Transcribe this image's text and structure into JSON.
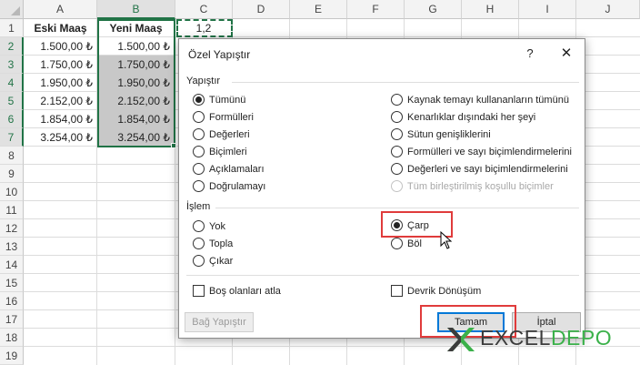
{
  "sheet": {
    "columns": [
      "A",
      "B",
      "C",
      "D",
      "E",
      "F",
      "G",
      "H",
      "I",
      "J"
    ],
    "rows": [
      "1",
      "2",
      "3",
      "4",
      "5",
      "6",
      "7",
      "8",
      "9",
      "10",
      "11",
      "12",
      "13",
      "14",
      "15",
      "16",
      "17",
      "18",
      "19"
    ],
    "header_row": {
      "a": "Eski Maaş",
      "b": "Yeni Maaş",
      "c": "1,2"
    },
    "data": [
      {
        "a": "1.500,00 ₺",
        "b": "1.500,00 ₺"
      },
      {
        "a": "1.750,00 ₺",
        "b": "1.750,00 ₺"
      },
      {
        "a": "1.950,00 ₺",
        "b": "1.950,00 ₺"
      },
      {
        "a": "2.152,00 ₺",
        "b": "2.152,00 ₺"
      },
      {
        "a": "1.854,00 ₺",
        "b": "1.854,00 ₺"
      },
      {
        "a": "3.254,00 ₺",
        "b": "3.254,00 ₺"
      }
    ],
    "selection_color": "#217346"
  },
  "dialog": {
    "title": "Özel Yapıştır",
    "help": "?",
    "close": "✕",
    "paste_group": "Yapıştır",
    "paste_left": [
      {
        "label": "Tümünü",
        "checked": true
      },
      {
        "label": "Formülleri",
        "checked": false
      },
      {
        "label": "Değerleri",
        "checked": false
      },
      {
        "label": "Biçimleri",
        "checked": false
      },
      {
        "label": "Açıklamaları",
        "checked": false
      },
      {
        "label": "Doğrulamayı",
        "checked": false
      }
    ],
    "paste_right": [
      {
        "label": "Kaynak temayı kullananların tümünü",
        "checked": false
      },
      {
        "label": "Kenarlıklar dışındaki her şeyi",
        "checked": false
      },
      {
        "label": "Sütun genişliklerini",
        "checked": false
      },
      {
        "label": "Formülleri ve sayı biçimlendirmelerini",
        "checked": false
      },
      {
        "label": "Değerleri ve sayı biçimlendirmelerini",
        "checked": false
      },
      {
        "label": "Tüm birleştirilmiş koşullu biçimler",
        "checked": false,
        "disabled": true
      }
    ],
    "operation_group": "İşlem",
    "operation_left": [
      {
        "label": "Yok",
        "checked": false
      },
      {
        "label": "Topla",
        "checked": false
      },
      {
        "label": "Çıkar",
        "checked": false
      }
    ],
    "operation_right": [
      {
        "label": "Çarp",
        "checked": true
      },
      {
        "label": "Böl",
        "checked": false
      }
    ],
    "skip_blanks": "Boş olanları atla",
    "transpose": "Devrik Dönüşüm",
    "paste_link": "Bağ Yapıştır",
    "ok": "Tamam",
    "cancel": "İptal"
  },
  "highlight_color": "#e03b3b",
  "watermark": {
    "part1": "EXCEL",
    "part2": "DEPO",
    "brand_dark": "#3c3c3c",
    "brand_green": "#3bb14a"
  }
}
